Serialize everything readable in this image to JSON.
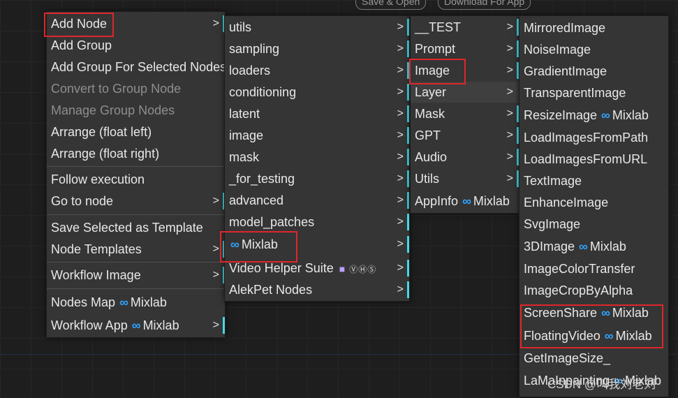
{
  "top_buttons": {
    "save_open": "Save & Open",
    "download_app": "Download For App"
  },
  "menu1": {
    "add_node": "Add Node",
    "add_group": "Add Group",
    "add_group_selected": "Add Group For Selected Nodes",
    "convert_group": "Convert to Group Node",
    "manage_group": "Manage Group Nodes",
    "arrange_left": "Arrange (float left)",
    "arrange_right": "Arrange (float right)",
    "follow_execution": "Follow execution",
    "go_to_node": "Go to node",
    "save_template": "Save Selected as Template",
    "node_templates": "Node Templates",
    "workflow_image": "Workflow Image",
    "nodes_map": "Nodes Map",
    "workflow_app": "Workflow App",
    "mixlab": "Mixlab"
  },
  "menu2": {
    "utils": "utils",
    "sampling": "sampling",
    "loaders": "loaders",
    "conditioning": "conditioning",
    "latent": "latent",
    "image": "image",
    "mask": "mask",
    "for_testing": "_for_testing",
    "advanced": "advanced",
    "model_patches": "model_patches",
    "mixlab": "Mixlab",
    "video_helper": "Video Helper Suite",
    "vhs_badge": "ⓋⒽⓈ",
    "alekpet": "AlekPet Nodes"
  },
  "menu3": {
    "test": "__TEST",
    "prompt": "Prompt",
    "image": "Image",
    "layer": "Layer",
    "mask": "Mask",
    "gpt": "GPT",
    "audio": "Audio",
    "utils": "Utils",
    "appinfo": "AppInfo",
    "mixlab": "Mixlab"
  },
  "menu4": {
    "mirrored": "MirroredImage",
    "noise": "NoiseImage",
    "gradient": "GradientImage",
    "transparent": "TransparentImage",
    "resize": "ResizeImage",
    "load_path": "LoadImagesFromPath",
    "load_url": "LoadImagesFromURL",
    "text": "TextImage",
    "enhance": "EnhanceImage",
    "svg": "SvgImage",
    "threed": "3DImage",
    "color_transfer": "ImageColorTransfer",
    "crop_alpha": "ImageCropByAlpha",
    "screenshare": "ScreenShare",
    "floating": "FloatingVideo",
    "get_size": "GetImageSize_",
    "lama": "LaMaInpainting",
    "mixlab": "Mixlab"
  },
  "symbols": {
    "arrow": ">",
    "infinity": "∞"
  },
  "watermark": "CSDN @叫我刘老刘",
  "colors": {
    "menu_bg": "#353535",
    "accent_bar": "#47d7e6",
    "highlight_box": "#e0262a",
    "mixlab_icon": "#2fa3ff"
  }
}
